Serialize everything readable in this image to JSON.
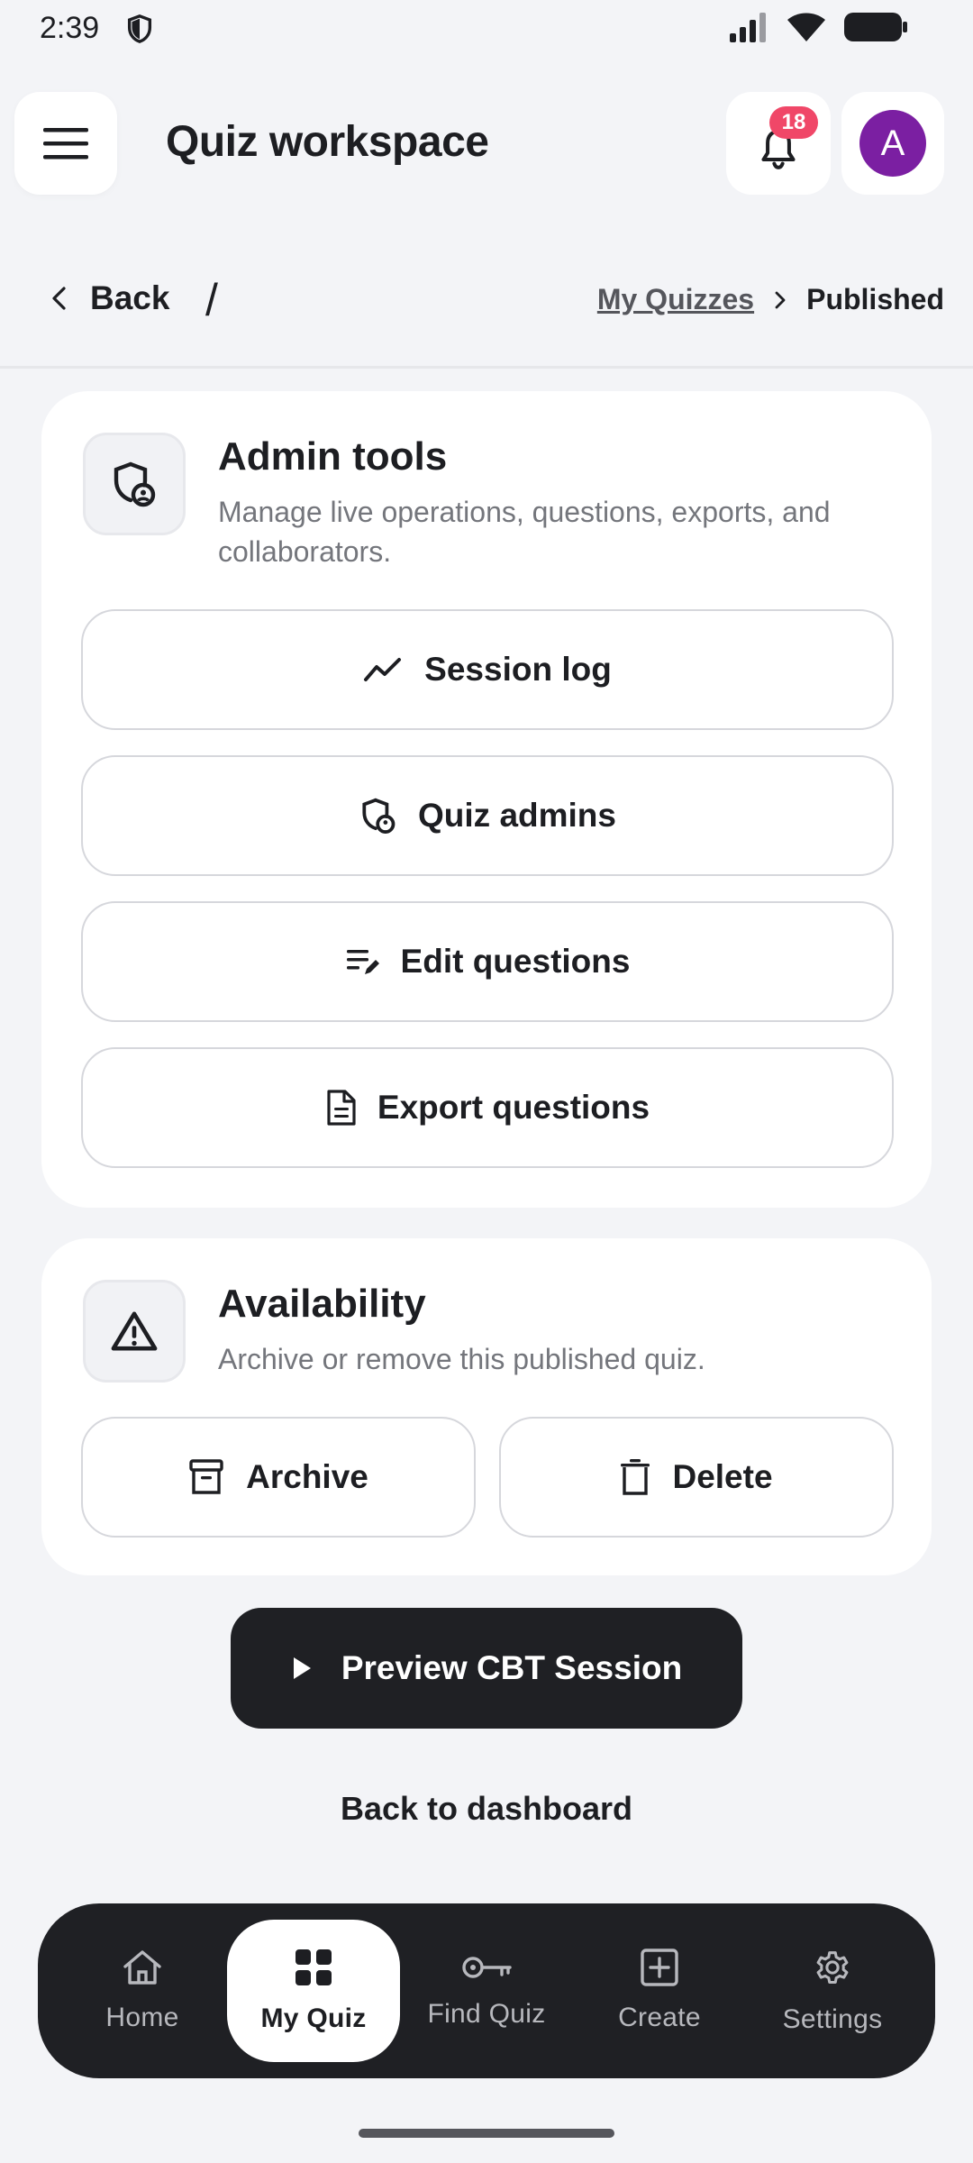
{
  "status_bar": {
    "time": "2:39"
  },
  "header": {
    "title": "Quiz workspace",
    "notification_count": "18",
    "avatar_initial": "A"
  },
  "breadcrumb": {
    "back_label": "Back",
    "separator": "/",
    "parent": "My Quizzes",
    "current": "Published"
  },
  "admin_tools": {
    "title": "Admin tools",
    "description": "Manage live operations, questions, exports, and collaborators.",
    "actions": [
      {
        "label": "Session log",
        "icon": "trend-line-icon"
      },
      {
        "label": "Quiz admins",
        "icon": "shield-user-icon"
      },
      {
        "label": "Edit questions",
        "icon": "edit-list-icon"
      },
      {
        "label": "Export questions",
        "icon": "document-icon"
      }
    ]
  },
  "availability": {
    "title": "Availability",
    "description": "Archive or remove this published quiz.",
    "archive_label": "Archive",
    "delete_label": "Delete"
  },
  "preview_button": {
    "label": "Preview CBT Session"
  },
  "dashboard_link": {
    "label": "Back to dashboard"
  },
  "bottom_nav": {
    "active": "My Quiz",
    "items": [
      {
        "label": "Home",
        "icon": "home-icon"
      },
      {
        "label": "My Quiz",
        "icon": "grid-icon"
      },
      {
        "label": "Find Quiz",
        "icon": "key-icon"
      },
      {
        "label": "Create",
        "icon": "plus-square-icon"
      },
      {
        "label": "Settings",
        "icon": "gear-icon"
      }
    ]
  },
  "colors": {
    "background": "#f3f4f7",
    "dark": "#1f2024",
    "badge": "#f04768",
    "avatar": "#7b1fa2"
  }
}
